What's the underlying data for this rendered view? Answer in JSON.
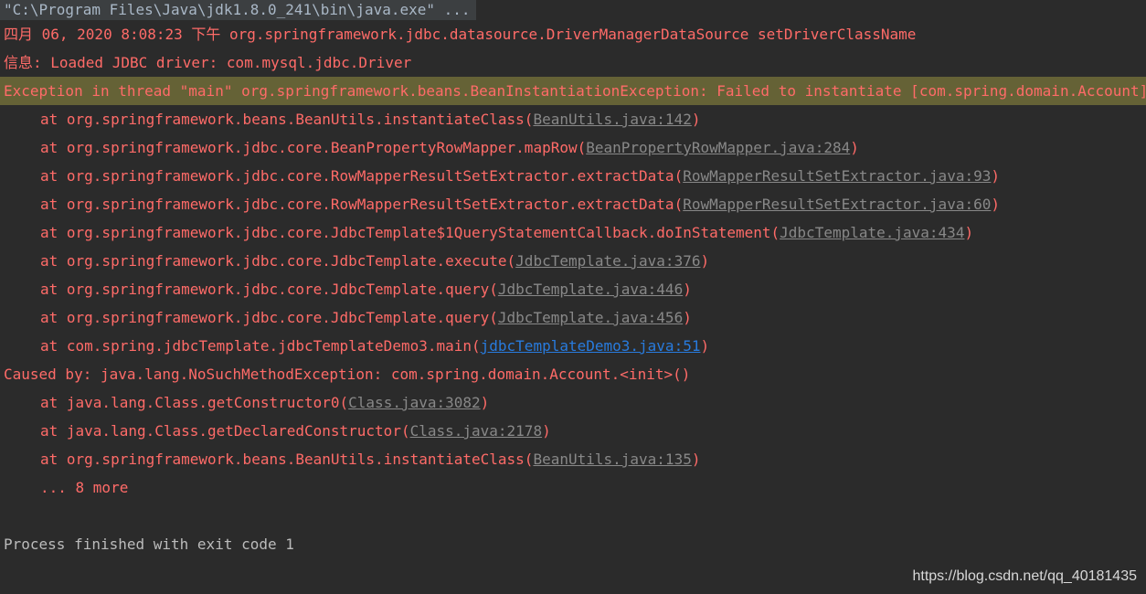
{
  "console": {
    "command": "\"C:\\Program Files\\Java\\jdk1.8.0_241\\bin\\java.exe\" ...",
    "log_line_1": "四月 06, 2020 8:08:23 下午 org.springframework.jdbc.datasource.DriverManagerDataSource setDriverClassName",
    "log_line_2": "信息: Loaded JDBC driver: com.mysql.jdbc.Driver",
    "exception_line": "Exception in thread \"main\" org.springframework.beans.BeanInstantiationException: Failed to instantiate [com.spring.domain.Account]: No default constructor found; nested exception is java.lang.NoSuchMethodException",
    "frames": [
      {
        "method": "at org.springframework.beans.BeanUtils.instantiateClass(",
        "link": "BeanUtils.java:142",
        "close": ")"
      },
      {
        "method": "at org.springframework.jdbc.core.BeanPropertyRowMapper.mapRow(",
        "link": "BeanPropertyRowMapper.java:284",
        "close": ")"
      },
      {
        "method": "at org.springframework.jdbc.core.RowMapperResultSetExtractor.extractData(",
        "link": "RowMapperResultSetExtractor.java:93",
        "close": ")"
      },
      {
        "method": "at org.springframework.jdbc.core.RowMapperResultSetExtractor.extractData(",
        "link": "RowMapperResultSetExtractor.java:60",
        "close": ")"
      },
      {
        "method": "at org.springframework.jdbc.core.JdbcTemplate$1QueryStatementCallback.doInStatement(",
        "link": "JdbcTemplate.java:434",
        "close": ")"
      },
      {
        "method": "at org.springframework.jdbc.core.JdbcTemplate.execute(",
        "link": "JdbcTemplate.java:376",
        "close": ")"
      },
      {
        "method": "at org.springframework.jdbc.core.JdbcTemplate.query(",
        "link": "JdbcTemplate.java:446",
        "close": ")"
      },
      {
        "method": "at org.springframework.jdbc.core.JdbcTemplate.query(",
        "link": "JdbcTemplate.java:456",
        "close": ")"
      },
      {
        "method": "at com.spring.jdbcTemplate.jdbcTemplateDemo3.main(",
        "link": "jdbcTemplateDemo3.java:51",
        "close": ")"
      }
    ],
    "caused_by": "Caused by: java.lang.NoSuchMethodException: com.spring.domain.Account.<init>()",
    "cause_frames": [
      {
        "method": "at java.lang.Class.getConstructor0(",
        "link": "Class.java:3082",
        "close": ")"
      },
      {
        "method": "at java.lang.Class.getDeclaredConstructor(",
        "link": "Class.java:2178",
        "close": ")"
      },
      {
        "method": "at org.springframework.beans.BeanUtils.instantiateClass(",
        "link": "BeanUtils.java:135",
        "close": ")"
      }
    ],
    "more": "... 8 more",
    "exit_message": "Process finished with exit code 1"
  },
  "watermark": "https://blog.csdn.net/qq_40181435",
  "colors": {
    "background": "#2b2b2b",
    "error_text": "#ff6b68",
    "normal_text": "#bbbbbb",
    "link_gray": "#888888",
    "link_user": "#287bde",
    "exception_highlight": "#656236"
  }
}
